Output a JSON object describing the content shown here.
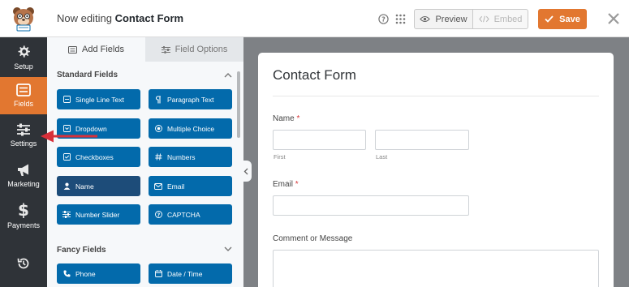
{
  "header": {
    "editing_prefix": "Now editing",
    "form_name": "Contact Form",
    "preview_label": "Preview",
    "embed_label": "Embed",
    "save_label": "Save"
  },
  "sidebar": {
    "items": [
      {
        "label": "Setup",
        "icon": "gear-icon"
      },
      {
        "label": "Fields",
        "icon": "fields-icon",
        "active": true
      },
      {
        "label": "Settings",
        "icon": "sliders-icon"
      },
      {
        "label": "Marketing",
        "icon": "megaphone-icon"
      },
      {
        "label": "Payments",
        "icon": "dollar-icon"
      },
      {
        "label": "",
        "icon": "history-icon"
      }
    ]
  },
  "panel": {
    "tabs": [
      {
        "label": "Add Fields",
        "icon": "list-icon"
      },
      {
        "label": "Field Options",
        "icon": "sliders-icon"
      }
    ],
    "standard_title": "Standard Fields",
    "standard_fields": [
      {
        "label": "Single Line Text",
        "icon": "text-line-icon"
      },
      {
        "label": "Paragraph Text",
        "icon": "paragraph-icon"
      },
      {
        "label": "Dropdown",
        "icon": "dropdown-icon"
      },
      {
        "label": "Multiple Choice",
        "icon": "radio-icon"
      },
      {
        "label": "Checkboxes",
        "icon": "checkbox-icon"
      },
      {
        "label": "Numbers",
        "icon": "hash-icon"
      },
      {
        "label": "Name",
        "icon": "user-icon"
      },
      {
        "label": "Email",
        "icon": "envelope-icon"
      },
      {
        "label": "Number Slider",
        "icon": "slider-icon"
      },
      {
        "label": "CAPTCHA",
        "icon": "captcha-icon"
      }
    ],
    "fancy_title": "Fancy Fields",
    "fancy_fields": [
      {
        "label": "Phone",
        "icon": "phone-icon"
      },
      {
        "label": "Date / Time",
        "icon": "calendar-icon"
      }
    ]
  },
  "form": {
    "title": "Contact Form",
    "name_label": "Name",
    "required_mark": "*",
    "first_label": "First",
    "last_label": "Last",
    "email_label": "Email",
    "comment_label": "Comment or Message"
  },
  "colors": {
    "accent": "#e27730",
    "nav_bg": "#2f3338",
    "field_button": "#036aab",
    "field_button_selected": "#1d4c79",
    "annotation_arrow": "#d8303a"
  }
}
